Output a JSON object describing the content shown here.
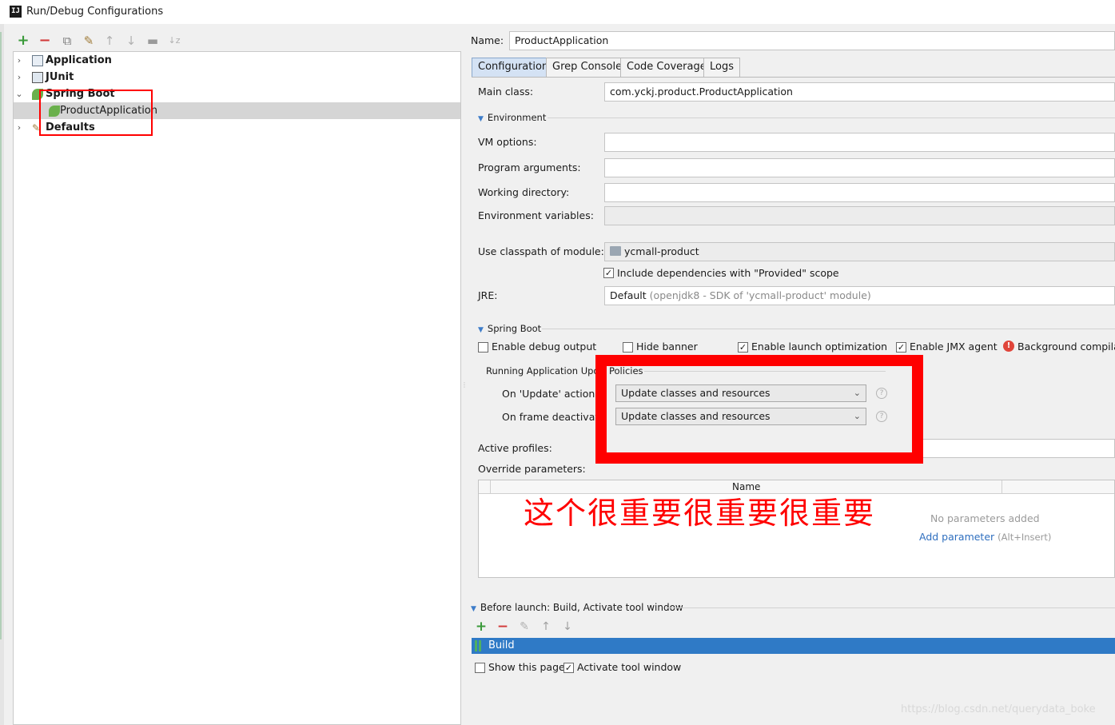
{
  "window": {
    "title": "Run/Debug Configurations",
    "logo_text": "IJ"
  },
  "toolbar": {
    "add": "+",
    "remove": "−",
    "copy": "⧉",
    "edit_defaults": "✎",
    "move_up": "↑",
    "move_down": "↓",
    "folder": "▬",
    "sort": "↓z"
  },
  "tree": {
    "items": [
      {
        "label": "Application",
        "arrow": "›"
      },
      {
        "label": "JUnit",
        "arrow": "›"
      },
      {
        "label": "Spring Boot",
        "arrow": "⌄"
      },
      {
        "label": "ProductApplication",
        "arrow": ""
      },
      {
        "label": "Defaults",
        "arrow": "›"
      }
    ]
  },
  "name_field": {
    "label": "Name:",
    "value": "ProductApplication"
  },
  "tabs": [
    "Configuration",
    "Grep Console",
    "Code Coverage",
    "Logs"
  ],
  "config": {
    "main_class": {
      "label": "Main class:",
      "value": "com.yckj.product.ProductApplication"
    },
    "environment_title": "Environment",
    "vm_options": {
      "label": "VM options:",
      "value": ""
    },
    "program_arguments": {
      "label": "Program arguments:",
      "value": ""
    },
    "working_directory": {
      "label": "Working directory:",
      "value": ""
    },
    "environment_variables": {
      "label": "Environment variables:",
      "value": ""
    },
    "classpath": {
      "label": "Use classpath of module:",
      "value": "ycmall-product"
    },
    "include_deps": {
      "label": "Include dependencies with \"Provided\" scope",
      "checked": true
    },
    "jre": {
      "label": "JRE:",
      "value": "Default",
      "hint": "(openjdk8 - SDK of 'ycmall-product' module)"
    }
  },
  "spring_boot": {
    "title": "Spring Boot",
    "enable_debug": {
      "label": "Enable debug output",
      "checked": false
    },
    "hide_banner": {
      "label": "Hide banner",
      "checked": false
    },
    "launch_opt": {
      "label": "Enable launch optimization",
      "checked": true
    },
    "jmx": {
      "label": "Enable JMX agent",
      "checked": true
    },
    "background_label": "Background compila",
    "policies_title_a": "Running Application Upd",
    "policies_title_b": "Policies",
    "update_action": {
      "label": "On 'Update' action:",
      "value": "Update classes and resources"
    },
    "frame_deactivation": {
      "label": "On frame deactivati",
      "value": "Update classes and resources"
    },
    "active_profiles": {
      "label": "Active profiles:",
      "value": ""
    },
    "override_params": {
      "label": "Override parameters:",
      "column": "Name",
      "empty_text": "No parameters added",
      "add_link": "Add parameter",
      "add_hint": "(Alt+Insert)"
    }
  },
  "annotation": {
    "text": "这个很重要很重要很重要",
    "color": "#ff0000"
  },
  "before_launch": {
    "title": "Before launch: Build, Activate tool window",
    "add": "+",
    "remove": "−",
    "edit": "✎",
    "up": "↑",
    "down": "↓",
    "item": "Build",
    "show_page": {
      "label": "Show this page",
      "checked": false
    },
    "activate": {
      "label": "Activate tool window",
      "checked": true
    }
  },
  "watermark": "https://blog.csdn.net/querydata_boke",
  "colors": {
    "accent": "#3d7cc9",
    "selection": "#2f7ac6",
    "annotation": "#ff0000",
    "tab_active": "#d4e2f4"
  }
}
